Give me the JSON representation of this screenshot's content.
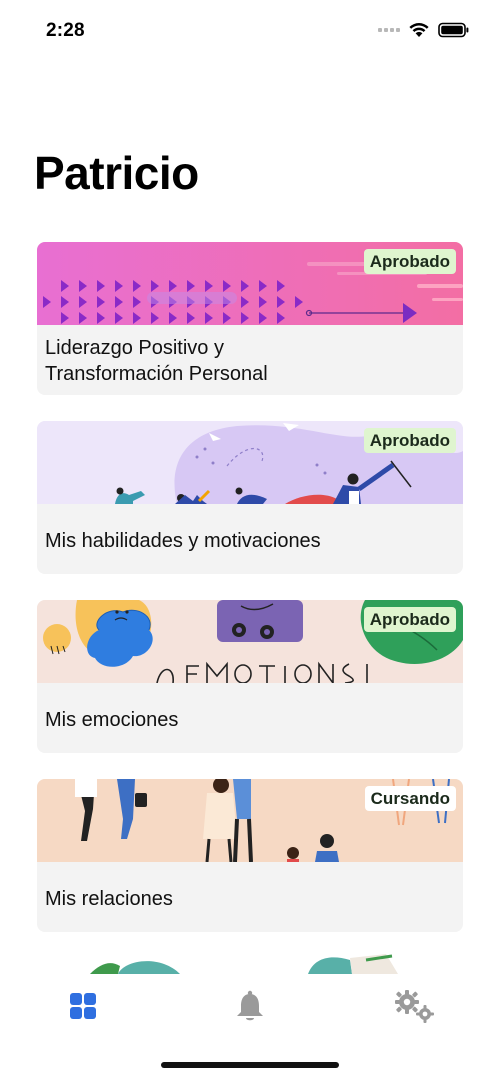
{
  "status_bar": {
    "time": "2:28",
    "icons": [
      "signal-icon",
      "wifi-icon",
      "battery-icon"
    ]
  },
  "page": {
    "title": "Patricio"
  },
  "courses": [
    {
      "title": "Liderazgo Positivo y Transformación Personal",
      "status": "Aprobado",
      "banner": "pink-triangles",
      "badge_color": "#dff5cf"
    },
    {
      "title": "Mis habilidades y motivaciones",
      "status": "Aprobado",
      "banner": "lavender-people",
      "badge_color": "#dff5cf"
    },
    {
      "title": "Mis emociones",
      "status": "Aprobado",
      "banner": "emotions-doodle",
      "badge_color": "#dff5cf"
    },
    {
      "title": "Mis relaciones",
      "status": "Cursando",
      "banner": "peach-people",
      "badge_color": "#ffffff"
    }
  ],
  "tab_bar": {
    "items": [
      {
        "name": "grid",
        "icon": "grid-icon",
        "active": true
      },
      {
        "name": "notifications",
        "icon": "bell-icon",
        "active": false
      },
      {
        "name": "settings",
        "icon": "gears-icon",
        "active": false
      }
    ],
    "active_color": "#2f6fe0",
    "inactive_color": "#9a9a9a"
  }
}
